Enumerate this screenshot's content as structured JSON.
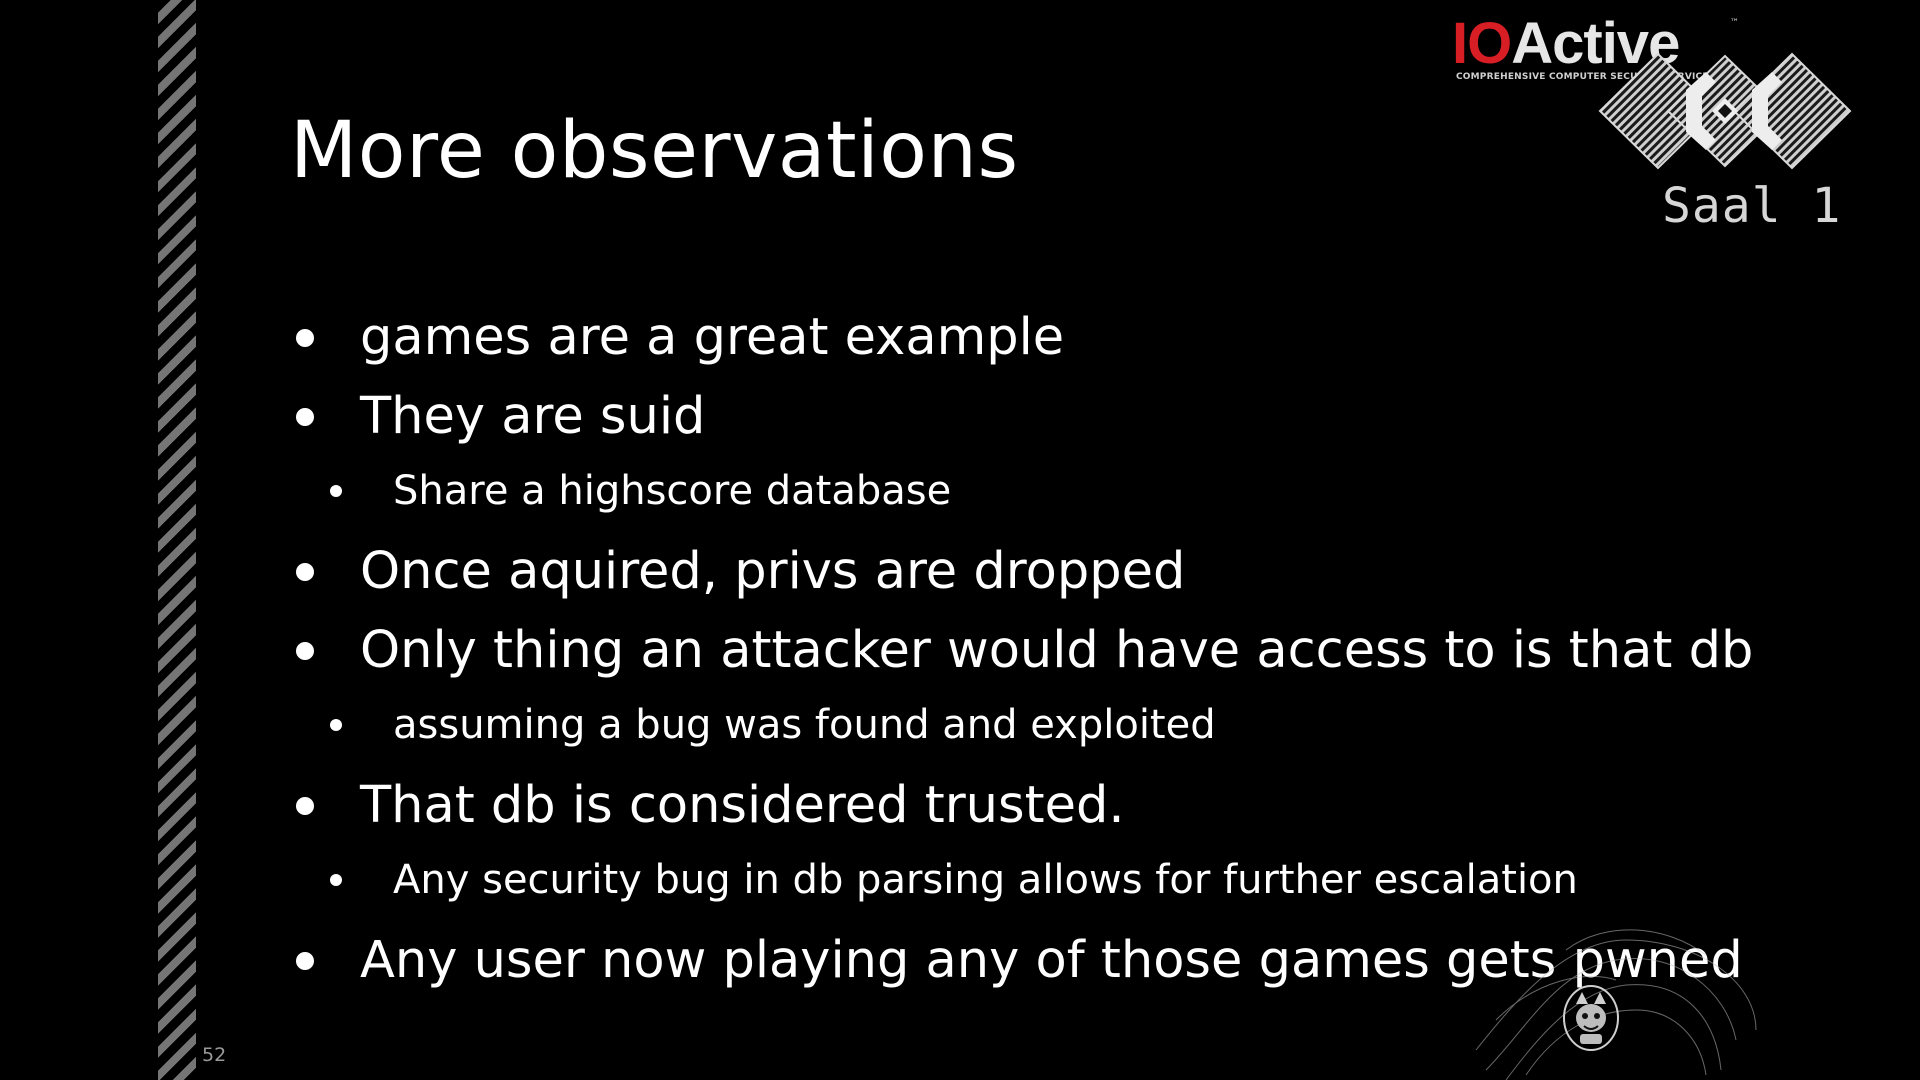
{
  "slide": {
    "title": "More observations",
    "bullets": [
      {
        "level": 1,
        "text": "games are a great example"
      },
      {
        "level": 1,
        "text": "They are suid"
      },
      {
        "level": 2,
        "text": "Share a highscore database"
      },
      {
        "level": 1,
        "text": "Once aquired, privs are dropped"
      },
      {
        "level": 1,
        "text": "Only thing an attacker would have access to is that db"
      },
      {
        "level": 2,
        "text": "assuming a bug was found and exploited"
      },
      {
        "level": 1,
        "text": "That db is considered trusted."
      },
      {
        "level": 2,
        "text": "Any security bug in db parsing allows for further escalation"
      },
      {
        "level": 1,
        "text": "Any user now playing any of those games gets pwned"
      }
    ],
    "page_number": "52"
  },
  "branding": {
    "company_logo": {
      "wordmark_io": "IO",
      "wordmark_rest": "Active",
      "trademark": "™",
      "tagline": "COMPREHENSIVE COMPUTER SECURITY SERVICES"
    },
    "event_logo_icon": "ccc-hexagon-logo-icon",
    "room_label": "Saal 1"
  },
  "colors": {
    "background": "#000000",
    "text": "#ffffff",
    "brand_accent": "#d81e25",
    "stripe": "#8a8a8a"
  }
}
